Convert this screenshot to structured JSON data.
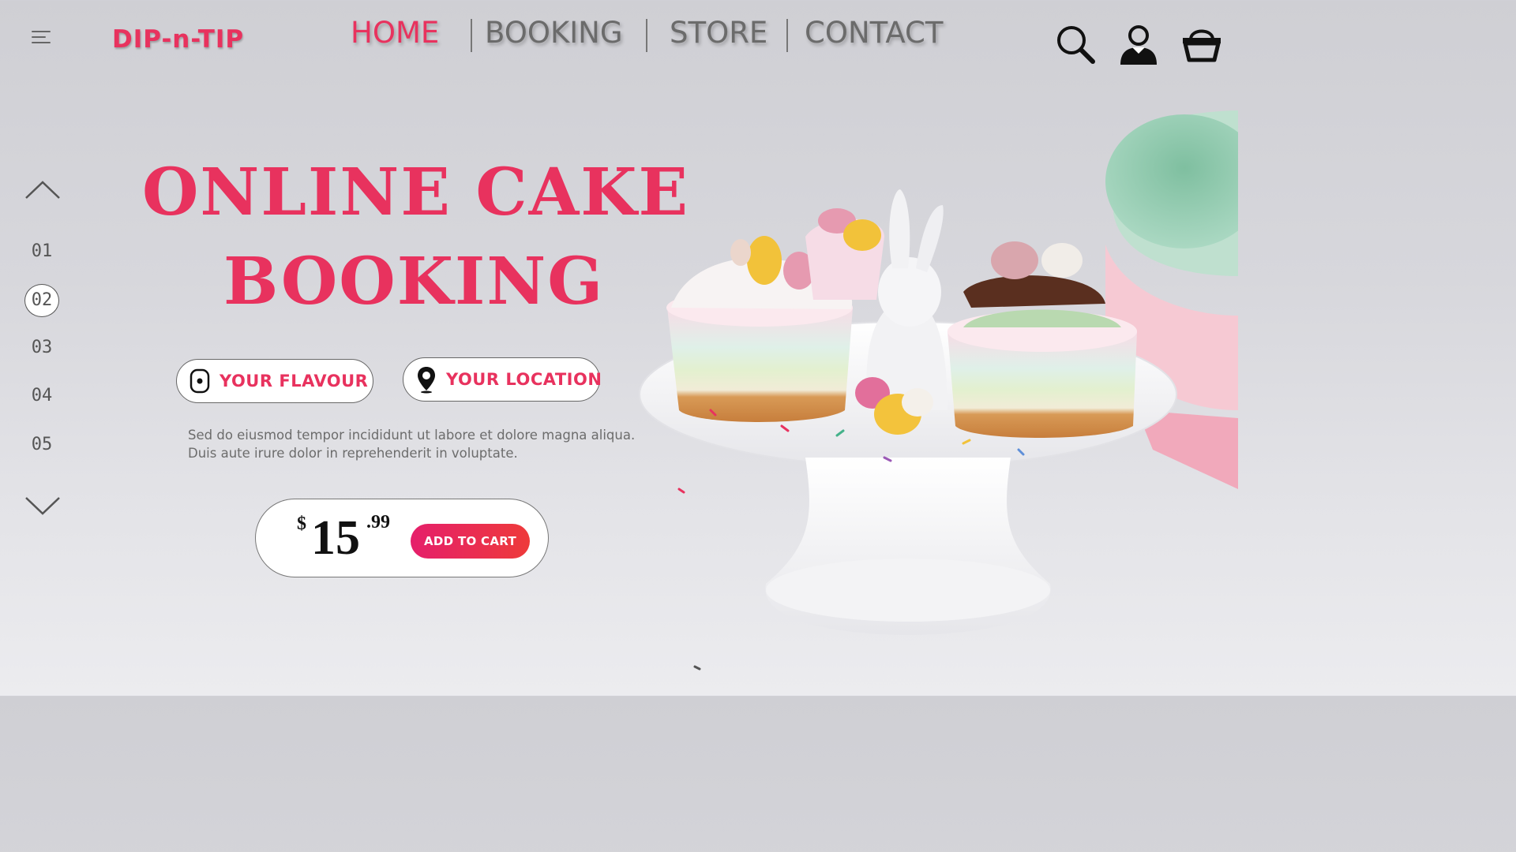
{
  "brand": {
    "logo": "DIP-n-TIP",
    "accent": "#e8325e"
  },
  "nav": {
    "items": [
      {
        "label": "HOME",
        "active": true
      },
      {
        "label": "BOOKING",
        "active": false
      },
      {
        "label": "STORE",
        "active": false
      },
      {
        "label": "CONTACT",
        "active": false
      }
    ]
  },
  "header_icons": [
    "search-icon",
    "user-icon",
    "cart-basket-icon"
  ],
  "pager": {
    "pages": [
      "01",
      "02",
      "03",
      "04",
      "05"
    ],
    "active": "02",
    "icons": [
      "chevron-up-icon",
      "chevron-down-icon"
    ]
  },
  "hero": {
    "title_line1": "ONLINE CAKE",
    "title_line2": "BOOKING",
    "flavour_label": "YOUR FLAVOUR",
    "location_label": "YOUR LOCATION",
    "description_line1": "Sed do eiusmod tempor incididunt ut labore et dolore magna aliqua.",
    "description_line2": "Duis aute irure dolor in reprehenderit in voluptate."
  },
  "price": {
    "currency": "$",
    "whole": "15",
    "cents": ".99"
  },
  "cart_button": {
    "label": "ADD TO CART",
    "gradient": [
      "#e51f6b",
      "#ee3a3a"
    ]
  },
  "photo": {
    "subject": "cupcakes-on-cake-stand"
  }
}
